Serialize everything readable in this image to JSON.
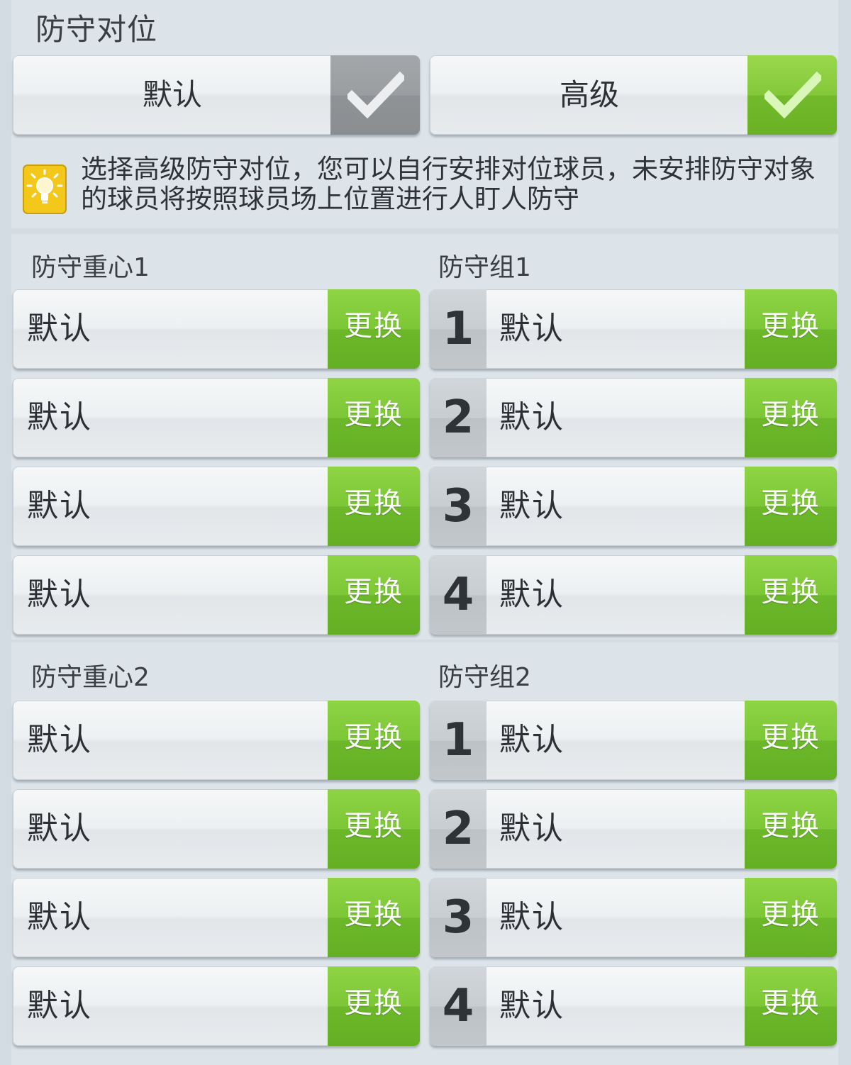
{
  "section_title": "防守对位",
  "modes": [
    {
      "label": "默认",
      "selected": false
    },
    {
      "label": "高级",
      "selected": true
    }
  ],
  "tip": {
    "line1": "选择高级防守对位，您可以自行安排对位球员，未安排防守对象",
    "line2": "的球员将按照球员场上位置进行人盯人防守",
    "icon": "lightbulb-icon"
  },
  "groups": [
    {
      "focus_title": "防守重心1",
      "group_title": "防守组1",
      "focus_rows": [
        "默认",
        "默认",
        "默认",
        "默认"
      ],
      "group_rows": [
        {
          "num": "1",
          "value": "默认"
        },
        {
          "num": "2",
          "value": "默认"
        },
        {
          "num": "3",
          "value": "默认"
        },
        {
          "num": "4",
          "value": "默认"
        }
      ]
    },
    {
      "focus_title": "防守重心2",
      "group_title": "防守组2",
      "focus_rows": [
        "默认",
        "默认",
        "默认",
        "默认"
      ],
      "group_rows": [
        {
          "num": "1",
          "value": "默认"
        },
        {
          "num": "2",
          "value": "默认"
        },
        {
          "num": "3",
          "value": "默认"
        },
        {
          "num": "4",
          "value": "默认"
        }
      ]
    }
  ],
  "swap_label": "更换",
  "colors": {
    "accent_green": "#7cc736",
    "inactive_gray": "#9a9ea1",
    "panel_bg": "#dce4ea"
  }
}
